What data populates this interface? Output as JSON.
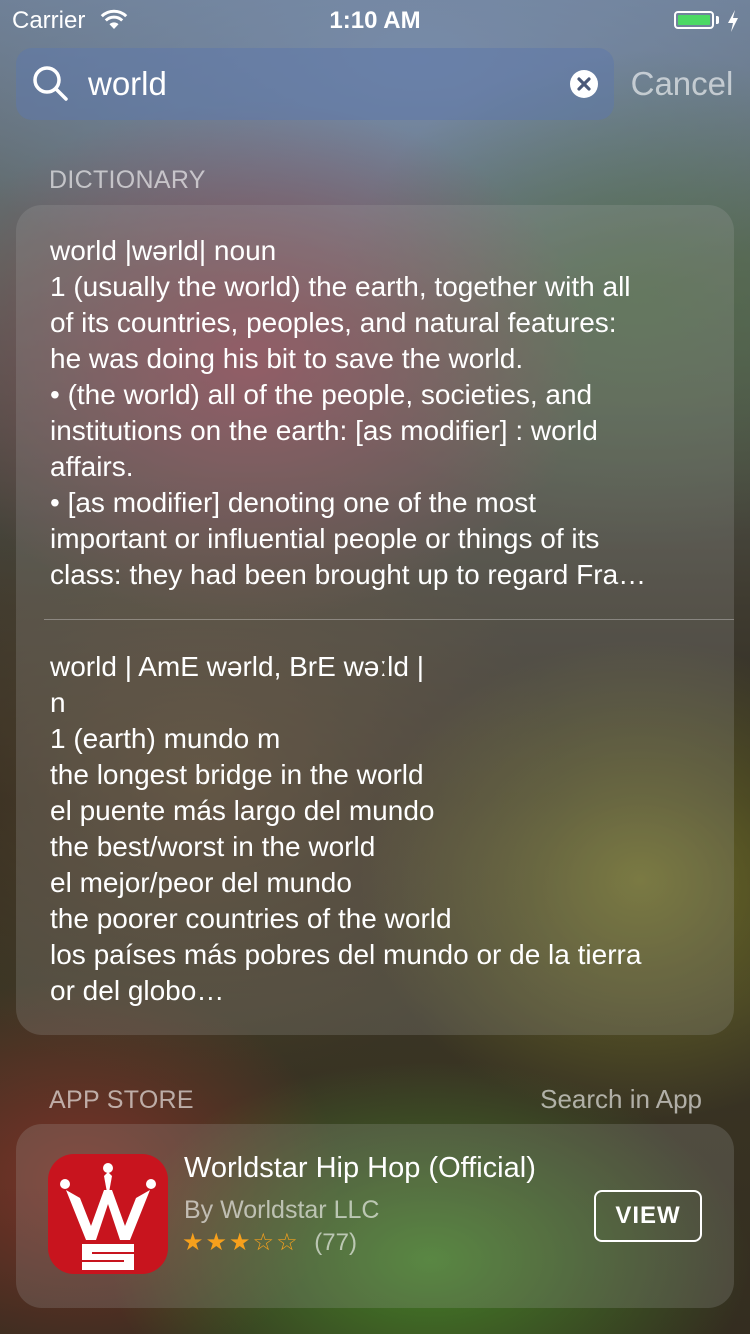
{
  "status_bar": {
    "carrier": "Carrier",
    "time": "1:10 AM",
    "battery_level": 1.0,
    "charging": true
  },
  "search": {
    "query": "world",
    "cancel_label": "Cancel"
  },
  "dictionary": {
    "header": "DICTIONARY",
    "entries": [
      {
        "lines": [
          "world |wərld| noun",
          "1 (usually the world) the earth, together with all",
          "of its countries, peoples, and natural features:",
          "he was doing his bit to save the world.",
          "• (the world) all of the people, societies, and",
          "institutions on the earth: [as modifier] : world",
          "affairs.",
          "• [as modifier] denoting one of the most",
          "important or influential people or things of its",
          "class: they had been brought up to regard Fra…"
        ]
      },
      {
        "lines": [
          "world | AmE wərld, BrE wəːld |",
          "n",
          "1 (earth) mundo m",
          "the longest bridge in the world",
          "el puente más largo del mundo",
          "the best/worst in the world",
          "el mejor/peor del mundo",
          "the poorer countries of the world",
          "los países más pobres del mundo or de la tierra",
          "or del globo…"
        ]
      }
    ]
  },
  "app_store": {
    "header": "APP STORE",
    "search_in_app_label": "Search in App",
    "app": {
      "name": "Worldstar Hip Hop (Official)",
      "developer": "By Worldstar LLC",
      "stars_display": "★★★☆☆",
      "rating": 3,
      "rating_count": "(77)",
      "view_label": "VIEW",
      "icon_color": "#c8141e"
    }
  },
  "colors": {
    "accent_star": "#f7a01c",
    "battery_green": "#4cd964"
  }
}
